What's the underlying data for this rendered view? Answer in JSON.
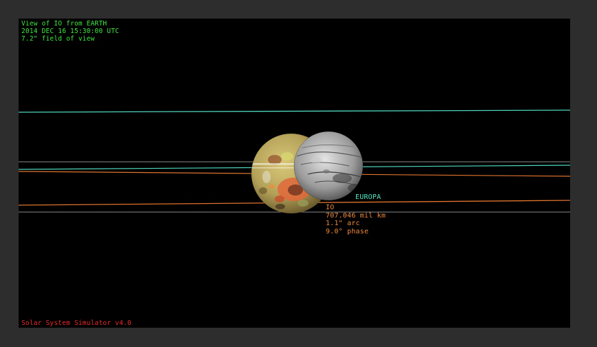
{
  "header": {
    "line1": "View of IO from EARTH",
    "line2": "2014 DEC 16 15:30:00 UTC",
    "line3": "7.2\" field of view"
  },
  "footer": {
    "app_name": "Solar System Simulator v4.0"
  },
  "bodies": {
    "europa": {
      "name": "EUROPA"
    },
    "io": {
      "name": "IO",
      "distance": "707.046 mil km",
      "arc": "1.1\" arc",
      "phase": "9.0° phase"
    }
  },
  "colors": {
    "hud_green": "#40e840",
    "hud_red": "#e82a2a",
    "europa_orbit": "#4fd6bd",
    "io_orbit": "#e0742e",
    "neutral_orbit": "#b8b8b8"
  }
}
